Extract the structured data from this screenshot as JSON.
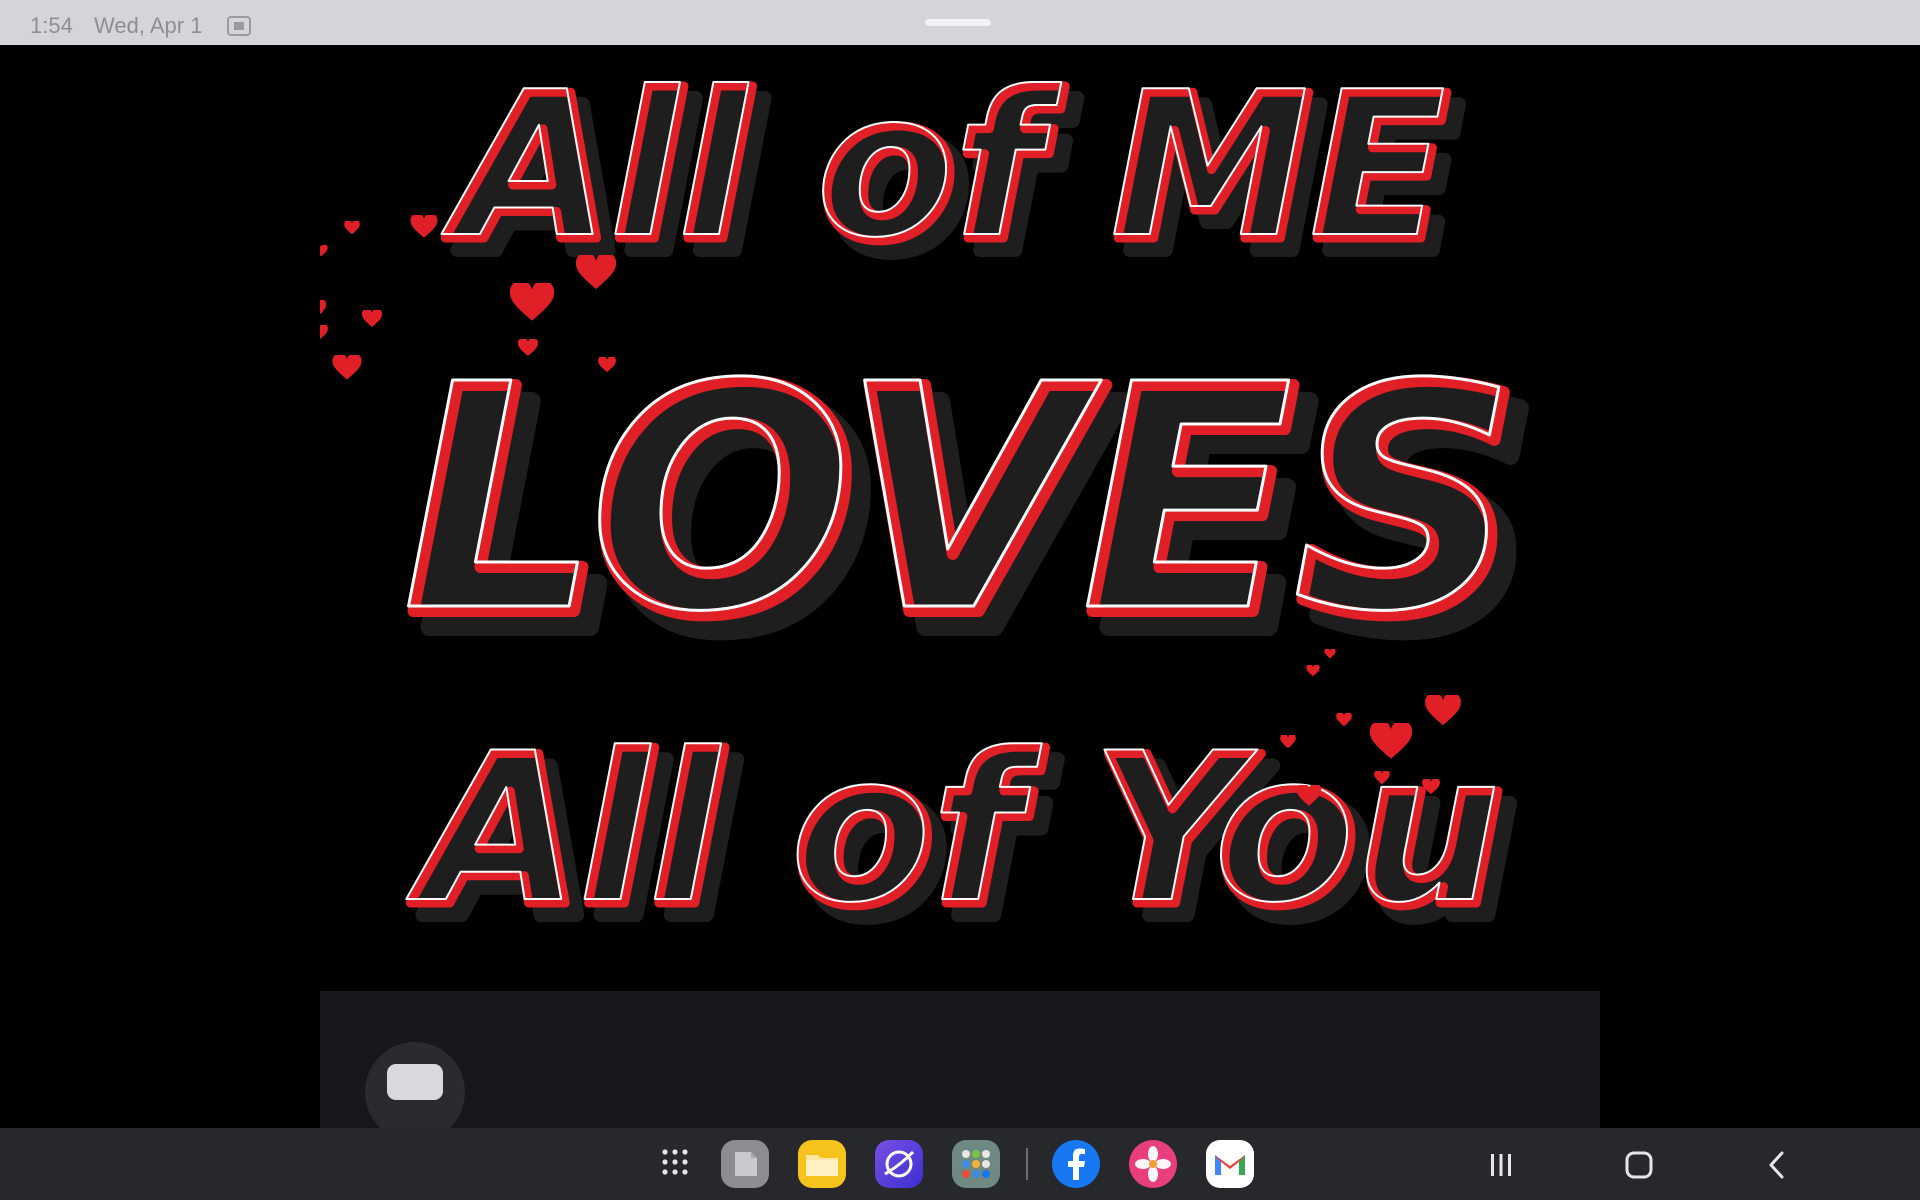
{
  "status_bar": {
    "time": "1:54",
    "date": "Wed, Apr 1",
    "icons": [
      "screenshot-icon"
    ]
  },
  "artwork": {
    "line1": "All of ME",
    "line2": "LOVES",
    "line3": "All of You",
    "colors": {
      "background": "#000000",
      "outline": "#e01f26",
      "fill": "#1e1e1e",
      "highlight": "#ffffff"
    }
  },
  "taskbar": {
    "apps": [
      {
        "name": "Apps",
        "icon": "apps-grid-icon"
      },
      {
        "name": "Notes",
        "icon": "notes-icon"
      },
      {
        "name": "My Files",
        "icon": "folder-icon"
      },
      {
        "name": "Browser",
        "icon": "browser-icon"
      },
      {
        "name": "App folder",
        "icon": "app-folder-icon"
      },
      {
        "name": "Facebook",
        "icon": "facebook-icon"
      },
      {
        "name": "Gallery",
        "icon": "gallery-icon"
      },
      {
        "name": "Gmail",
        "icon": "gmail-icon"
      }
    ],
    "nav": [
      "recents-icon",
      "home-icon",
      "back-icon"
    ]
  }
}
